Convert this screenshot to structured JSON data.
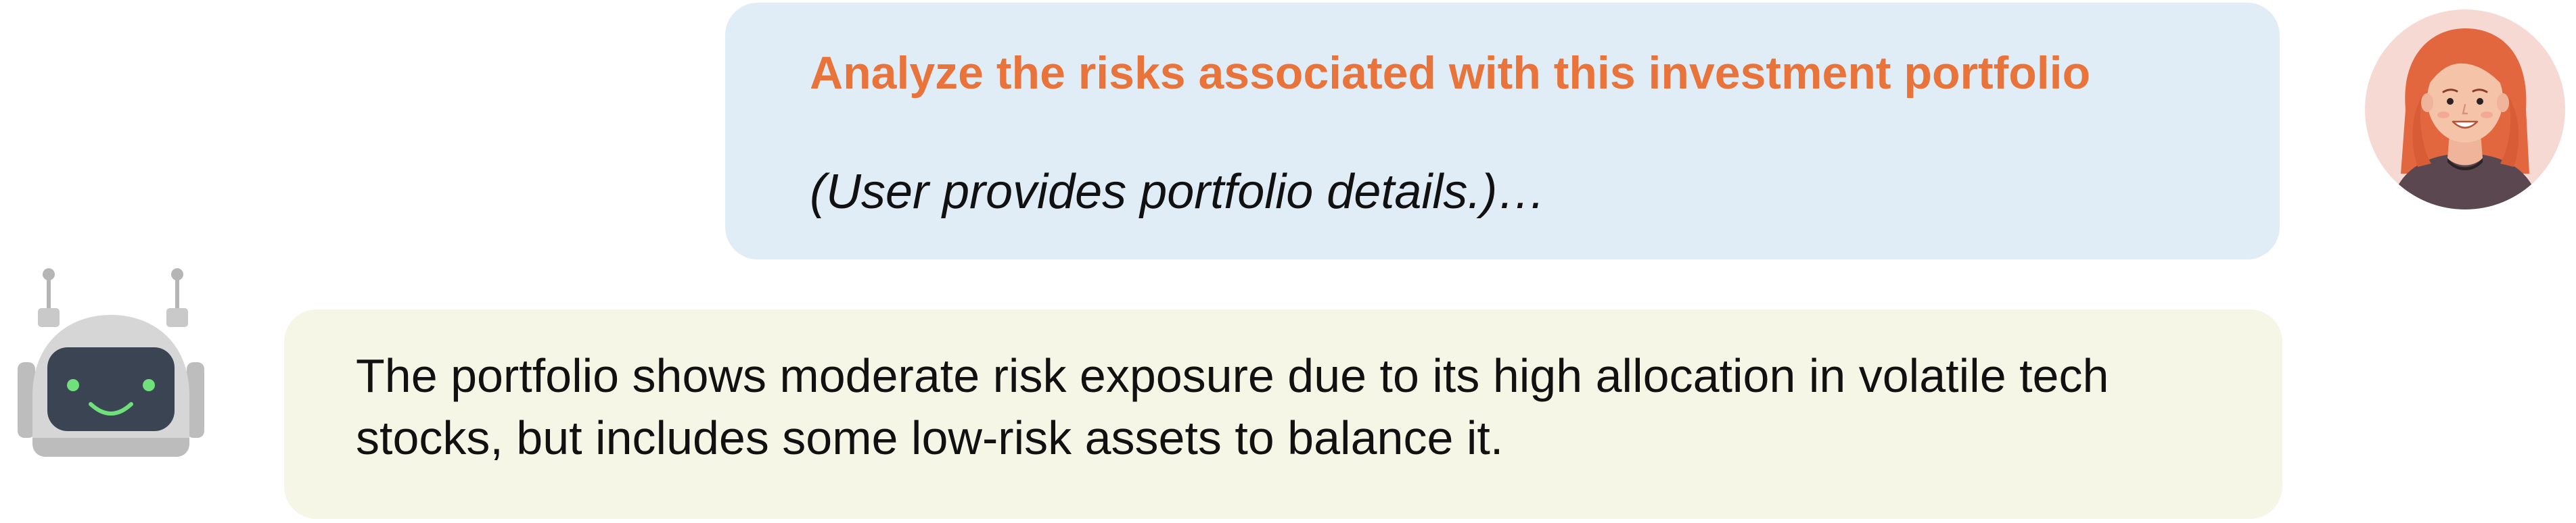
{
  "user_message": {
    "title": "Analyze the risks associated with this investment portfolio",
    "note": "(User provides portfolio details.)…",
    "avatar_icon": "woman-avatar-icon",
    "title_color": "#e8743b",
    "bubble_color": "#e1edf6"
  },
  "assistant_message": {
    "text": "The portfolio shows moderate risk exposure due to its high allocation in volatile tech stocks, but includes some low-risk assets to balance it.",
    "avatar_icon": "robot-avatar-icon",
    "bubble_color": "#f5f6e5"
  }
}
